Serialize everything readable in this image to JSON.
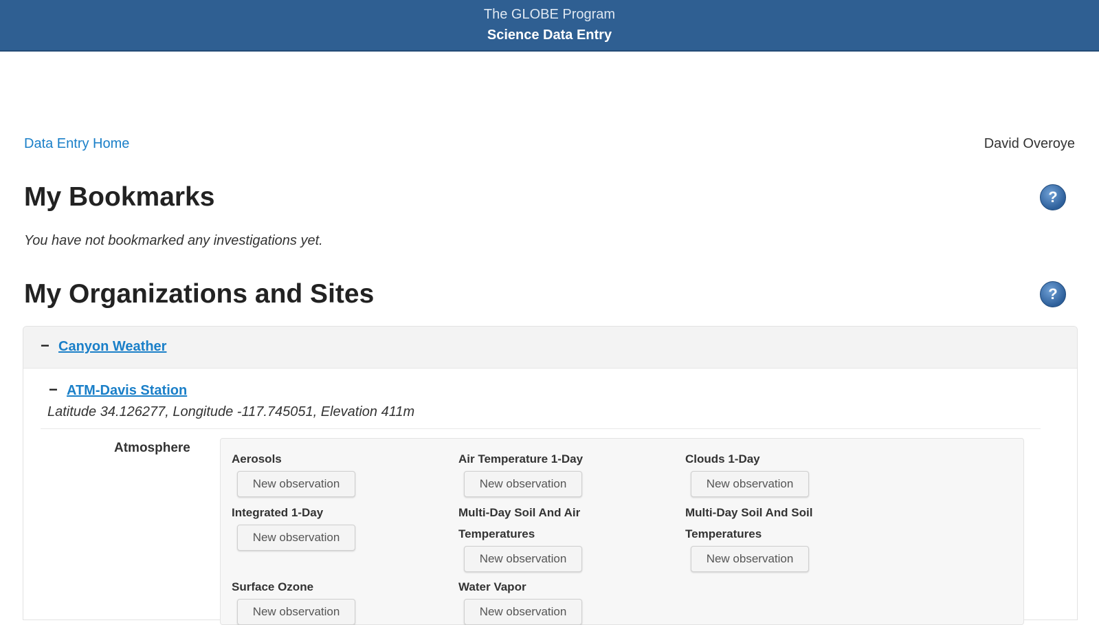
{
  "header": {
    "program": "The GLOBE Program",
    "app_title": "Science Data Entry"
  },
  "nav": {
    "home_link": "Data Entry Home",
    "user_name": "David Overoye"
  },
  "bookmarks": {
    "title": "My Bookmarks",
    "empty_message": "You have not bookmarked any investigations yet.",
    "help_icon": "help-icon"
  },
  "organizations": {
    "title": "My Organizations and Sites",
    "help_icon": "help-icon",
    "org": {
      "toggle": "−",
      "name": "Canyon Weather",
      "site": {
        "toggle": "−",
        "name": "ATM-Davis Station",
        "coords": "Latitude 34.126277, Longitude -117.745051, Elevation 411m",
        "category": "Atmosphere",
        "protocols": [
          {
            "name": "Aerosols",
            "button": "New observation"
          },
          {
            "name": "Air Temperature 1-Day",
            "button": "New observation"
          },
          {
            "name": "Clouds 1-Day",
            "button": "New observation"
          },
          {
            "name": "Integrated 1-Day",
            "button": "New observation"
          },
          {
            "name_line1": "Multi-Day Soil And Air",
            "name_line2": "Temperatures",
            "button": "New observation"
          },
          {
            "name_line1": "Multi-Day Soil And Soil",
            "name_line2": "Temperatures",
            "button": "New observation"
          },
          {
            "name": "Surface Ozone",
            "button": "New observation"
          },
          {
            "name": "Water Vapor",
            "button": "New observation"
          }
        ]
      }
    }
  }
}
